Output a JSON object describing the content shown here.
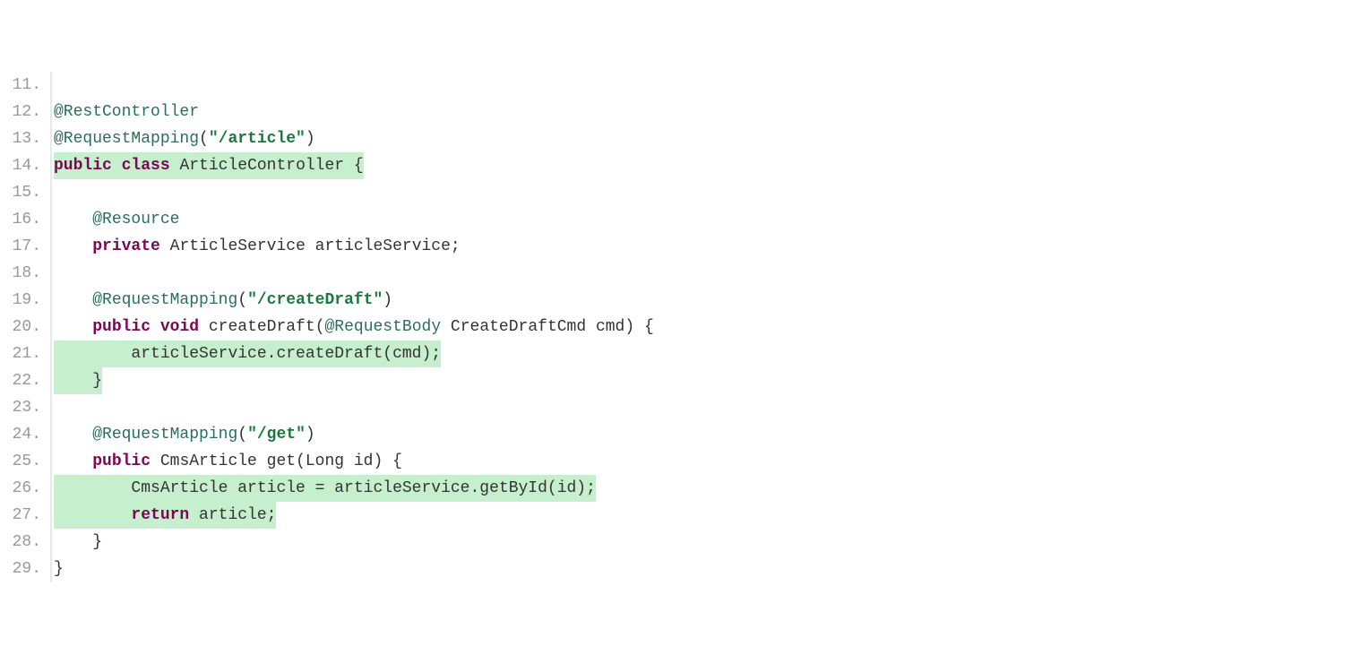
{
  "lines": [
    {
      "number": "11.",
      "highlighted": false,
      "tokens": []
    },
    {
      "number": "12.",
      "highlighted": false,
      "tokens": [
        {
          "text": "@RestController",
          "class": "annotation"
        }
      ]
    },
    {
      "number": "13.",
      "highlighted": false,
      "tokens": [
        {
          "text": "@RequestMapping",
          "class": "annotation"
        },
        {
          "text": "(",
          "class": "paren"
        },
        {
          "text": "\"/article\"",
          "class": "string"
        },
        {
          "text": ")",
          "class": "paren"
        }
      ]
    },
    {
      "number": "14.",
      "highlighted": true,
      "tokens": [
        {
          "text": "public",
          "class": "keyword"
        },
        {
          "text": " ",
          "class": "plain"
        },
        {
          "text": "class",
          "class": "keyword"
        },
        {
          "text": " ",
          "class": "plain"
        },
        {
          "text": "ArticleController {",
          "class": "plain"
        }
      ]
    },
    {
      "number": "15.",
      "highlighted": false,
      "tokens": []
    },
    {
      "number": "16.",
      "highlighted": false,
      "indent": "    ",
      "tokens": [
        {
          "text": "@Resource",
          "class": "annotation"
        }
      ]
    },
    {
      "number": "17.",
      "highlighted": false,
      "indent": "    ",
      "tokens": [
        {
          "text": "private",
          "class": "keyword"
        },
        {
          "text": " ",
          "class": "plain"
        },
        {
          "text": "ArticleService articleService;",
          "class": "plain"
        }
      ]
    },
    {
      "number": "18.",
      "highlighted": false,
      "tokens": []
    },
    {
      "number": "19.",
      "highlighted": false,
      "indent": "    ",
      "tokens": [
        {
          "text": "@RequestMapping",
          "class": "annotation"
        },
        {
          "text": "(",
          "class": "paren"
        },
        {
          "text": "\"/createDraft\"",
          "class": "string"
        },
        {
          "text": ")",
          "class": "paren"
        }
      ]
    },
    {
      "number": "20.",
      "highlighted": false,
      "indent": "    ",
      "tokens": [
        {
          "text": "public",
          "class": "keyword"
        },
        {
          "text": " ",
          "class": "plain"
        },
        {
          "text": "void",
          "class": "keyword"
        },
        {
          "text": " ",
          "class": "plain"
        },
        {
          "text": "createDraft(",
          "class": "plain"
        },
        {
          "text": "@RequestBody",
          "class": "annotation"
        },
        {
          "text": " CreateDraftCmd cmd) {",
          "class": "plain"
        }
      ]
    },
    {
      "number": "21.",
      "highlighted": true,
      "indent": "        ",
      "tokens": [
        {
          "text": "articleService.createDraft(cmd);",
          "class": "plain"
        }
      ]
    },
    {
      "number": "22.",
      "highlighted": true,
      "indent": "    ",
      "tokens": [
        {
          "text": "}",
          "class": "plain"
        }
      ]
    },
    {
      "number": "23.",
      "highlighted": false,
      "tokens": []
    },
    {
      "number": "24.",
      "highlighted": false,
      "indent": "    ",
      "tokens": [
        {
          "text": "@RequestMapping",
          "class": "annotation"
        },
        {
          "text": "(",
          "class": "paren"
        },
        {
          "text": "\"/get\"",
          "class": "string"
        },
        {
          "text": ")",
          "class": "paren"
        }
      ]
    },
    {
      "number": "25.",
      "highlighted": false,
      "indent": "    ",
      "tokens": [
        {
          "text": "public",
          "class": "keyword"
        },
        {
          "text": " ",
          "class": "plain"
        },
        {
          "text": "CmsArticle get(Long id) {",
          "class": "plain"
        }
      ]
    },
    {
      "number": "26.",
      "highlighted": true,
      "indent": "        ",
      "tokens": [
        {
          "text": "CmsArticle article = articleService.getById(id);",
          "class": "plain"
        }
      ]
    },
    {
      "number": "27.",
      "highlighted": true,
      "indent": "        ",
      "tokens": [
        {
          "text": "return",
          "class": "keyword"
        },
        {
          "text": " article;",
          "class": "plain"
        }
      ]
    },
    {
      "number": "28.",
      "highlighted": false,
      "indent": "    ",
      "tokens": [
        {
          "text": "}",
          "class": "plain"
        }
      ]
    },
    {
      "number": "29.",
      "highlighted": false,
      "tokens": [
        {
          "text": "}",
          "class": "plain"
        }
      ]
    }
  ]
}
